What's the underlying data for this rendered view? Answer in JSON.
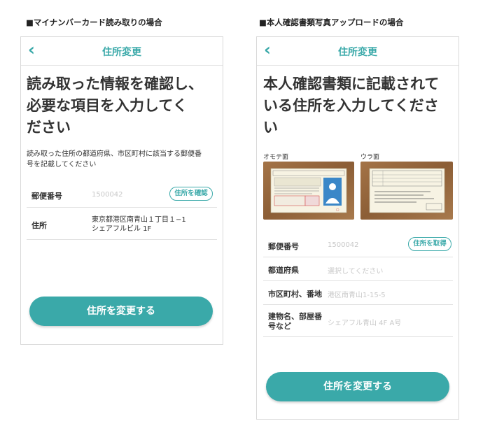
{
  "left": {
    "caption": "■マイナンバーカード読み取りの場合",
    "nav": {
      "back_icon": "chevron-left-icon",
      "title": "住所変更"
    },
    "heading": [
      "読み取った情報を確認し、",
      "必要な項目を入力してく",
      "ださい"
    ],
    "description": [
      "読み取った住所の都道府県、市区町村に該当する郵便番",
      "号を記載してください"
    ],
    "postal": {
      "label": "郵便番号",
      "value": "1500042",
      "button": "住所を確認"
    },
    "address": {
      "label": "住所",
      "line1": "東京都港区南青山１丁目１−1",
      "line2": "シェアフルビル 1F"
    },
    "submit": "住所を変更する"
  },
  "right": {
    "caption": "■本人確認書類写真アップロードの場合",
    "nav": {
      "back_icon": "chevron-left-icon",
      "title": "住所変更"
    },
    "heading": [
      "本人確認書類に記載されて",
      "いる住所を入力してくださ",
      "い"
    ],
    "front_label": "オモテ面",
    "back_label": "ウラ面",
    "postal": {
      "label": "郵便番号",
      "placeholder": "1500042",
      "button": "住所を取得"
    },
    "prefecture": {
      "label": "都道府県",
      "placeholder": "選択してください"
    },
    "city": {
      "label": "市区町村、番地",
      "placeholder": "港区南青山1-15-5"
    },
    "building": {
      "label": "建物名、部屋番号など",
      "placeholder": "シェアフル青山 4F A号"
    },
    "submit": "住所を変更する"
  },
  "colors": {
    "accent": "#3aa9a9",
    "border": "#d9d9d9",
    "divider": "#e2e2e2",
    "placeholder": "#c8c8c8"
  }
}
